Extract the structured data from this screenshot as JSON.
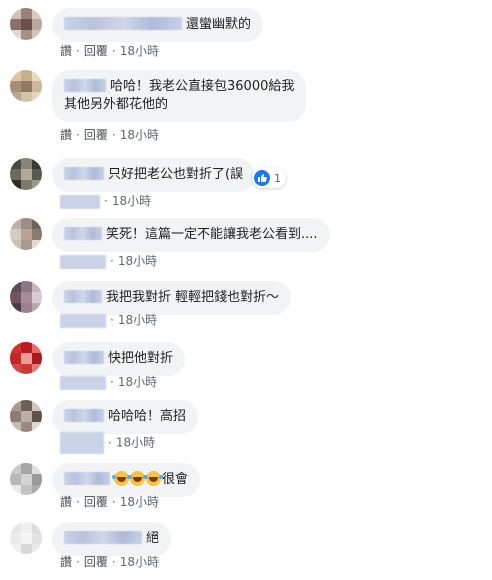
{
  "actions": {
    "like": "讚",
    "reply": "回覆",
    "dot": "·"
  },
  "comments": [
    {
      "text": "還蠻幽默的",
      "time": "18小時",
      "avatar": [
        "#cfc0ba",
        "#9a8078",
        "#d9c9c3",
        "#8a7068",
        "#6b5048",
        "#b8a8a0",
        "#e0d6d2",
        "#a89088",
        "#cfc5c0"
      ]
    },
    {
      "text": "哈哈！我老公直接包36000給我",
      "text2": "其他另外都花他的",
      "time": "18小時",
      "avatar": [
        "#d9c7a8",
        "#c9b08c",
        "#e7d8c0",
        "#a88d70",
        "#8f7a62",
        "#cdb79c",
        "#b9a68e",
        "#d4c2a8",
        "#e2d5c2"
      ]
    },
    {
      "text": "只好把老公也對折了(誤",
      "time": "18小時",
      "reaction_count": "1",
      "avatar": [
        "#4a4a44",
        "#8a8478",
        "#3c3a36",
        "#6c6a60",
        "#b0a898",
        "#5a5850",
        "#2e2c28",
        "#7c786c",
        "#a09a8c"
      ]
    },
    {
      "text": "笑死！這篇一定不能讓我老公看到....",
      "time": "18小時",
      "avatar": [
        "#bdb1a6",
        "#9c8e82",
        "#6e625a",
        "#d6cbc2",
        "#b8a292",
        "#8a7c70",
        "#ccc2b8",
        "#a99a8e",
        "#e2dad2"
      ]
    },
    {
      "text": "我把我對折 輕輕把錢也對折～",
      "time": "18小時",
      "avatar": [
        "#5c4e58",
        "#8d7682",
        "#c7b3bd",
        "#6e5560",
        "#a88d98",
        "#d8cad0",
        "#4a3c46",
        "#9b8290",
        "#bda6b2"
      ]
    },
    {
      "text": "快把他對折",
      "time": "18小時",
      "avatar": [
        "#d43030",
        "#b81c22",
        "#e86a64",
        "#c02828",
        "#f09c94",
        "#a61a20",
        "#dc4444",
        "#c83a3a",
        "#e47a70"
      ]
    },
    {
      "text": "哈哈哈！高招",
      "time": "18小時",
      "avatar": [
        "#a89a90",
        "#6c6058",
        "#d2c6bc",
        "#8c7e74",
        "#bcae a2",
        "#5e544c",
        "#c8bcb2",
        "#988a80",
        "#e0d6cc"
      ]
    },
    {
      "text": "很會",
      "time": "18小時",
      "avatar": [
        "#cacaca",
        "#a6a6a6",
        "#e0e0e0",
        "#b8b8b8",
        "#d4d4d4",
        "#9a9a9a",
        "#e8e8e8",
        "#c2c2c2",
        "#ababab"
      ]
    },
    {
      "text": "絕",
      "time": "18小時",
      "avatar": [
        "#e6e6e6",
        "#f0f0f0",
        "#dcdcdc",
        "#ebebeb",
        "#f4f4f4",
        "#e2e2e2",
        "#efefef",
        "#d8d8d8",
        "#e9e9e9"
      ]
    }
  ]
}
